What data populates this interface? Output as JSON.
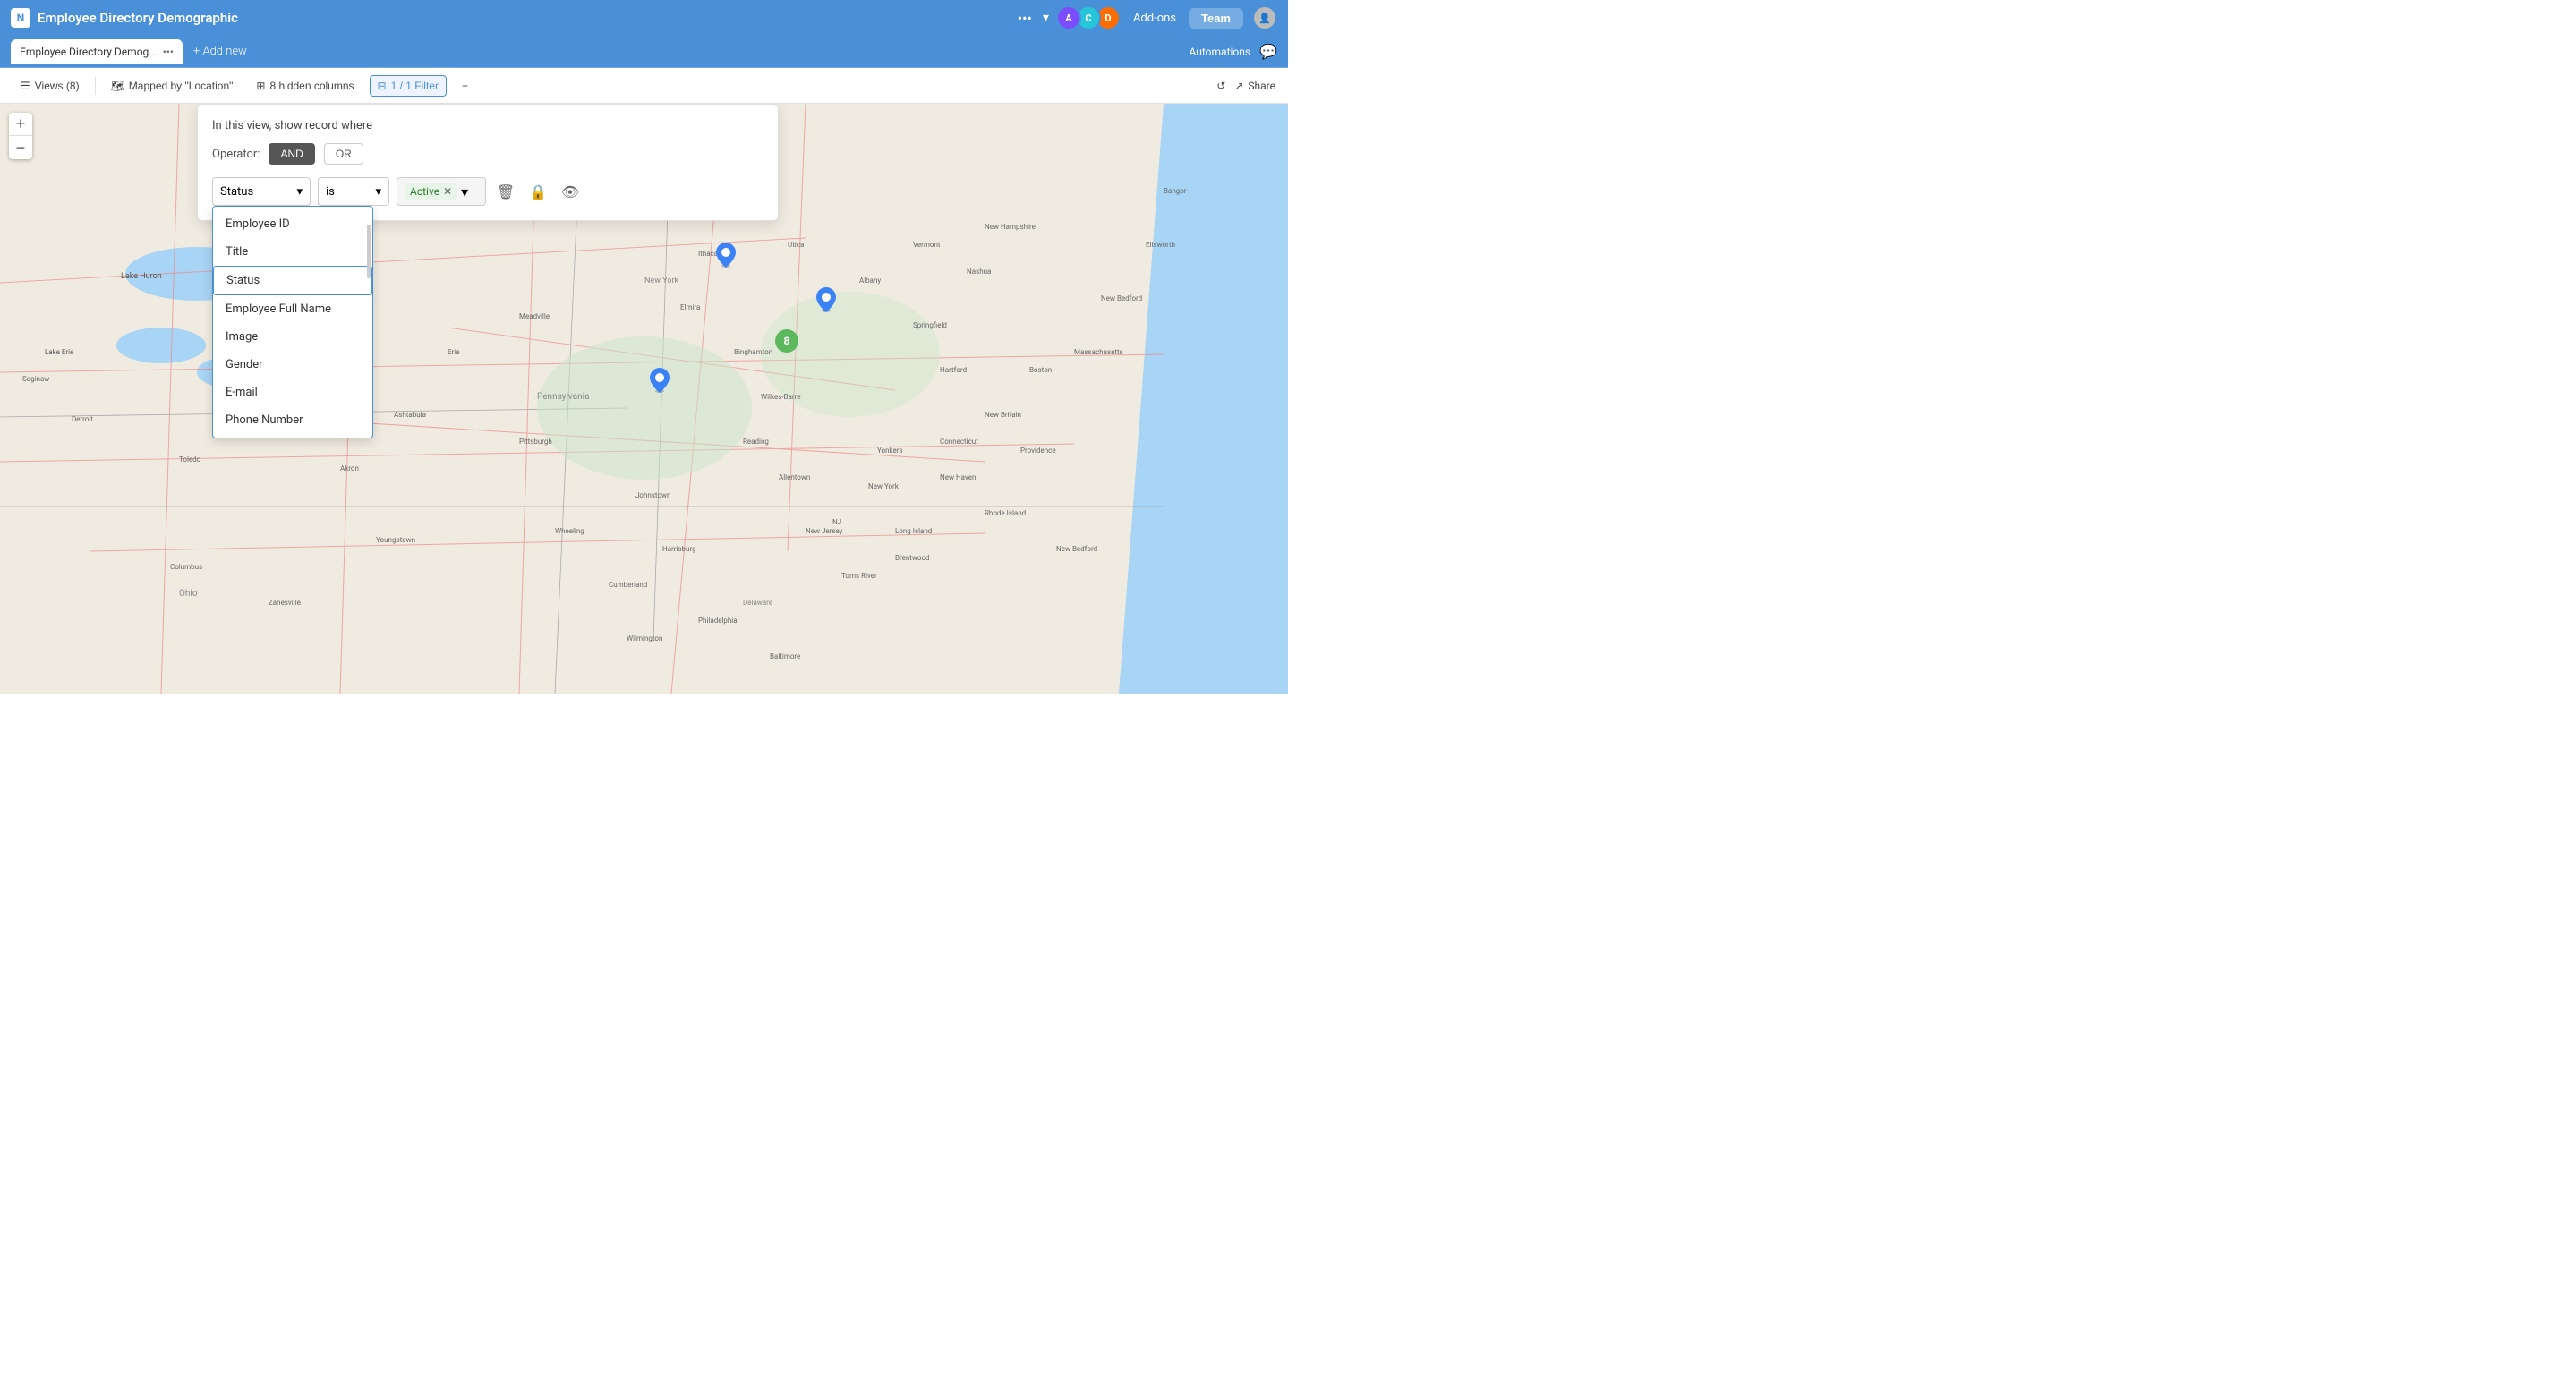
{
  "app": {
    "title": "Employee Directory Demographic",
    "logo_initial": "N"
  },
  "top_nav": {
    "dots_label": "•••",
    "chevron": "▾",
    "addons": "Add-ons",
    "team": "Team"
  },
  "tab": {
    "name": "Employee Directory Demog...",
    "dots": "•••",
    "add": "+ Add new",
    "automations": "Automations"
  },
  "toolbar": {
    "views_label": "Views (8)",
    "mapped_label": "Mapped by \"Location\"",
    "hidden_label": "8 hidden columns",
    "filter_label": "1 / 1 Filter",
    "add_icon": "+",
    "undo_icon": "↺",
    "share_label": "Share"
  },
  "filter_panel": {
    "header": "In this view, show record where",
    "operator_label": "Operator:",
    "operator_and": "AND",
    "operator_or": "OR",
    "field_value": "Status",
    "condition_value": "is",
    "filter_value": "Active",
    "field_options": [
      "Employee ID",
      "Title",
      "Status",
      "Employee Full Name",
      "Image",
      "Gender",
      "E-mail",
      "Phone Number"
    ]
  },
  "map": {
    "zoom_in": "+",
    "zoom_out": "−",
    "cluster_count": "8"
  }
}
